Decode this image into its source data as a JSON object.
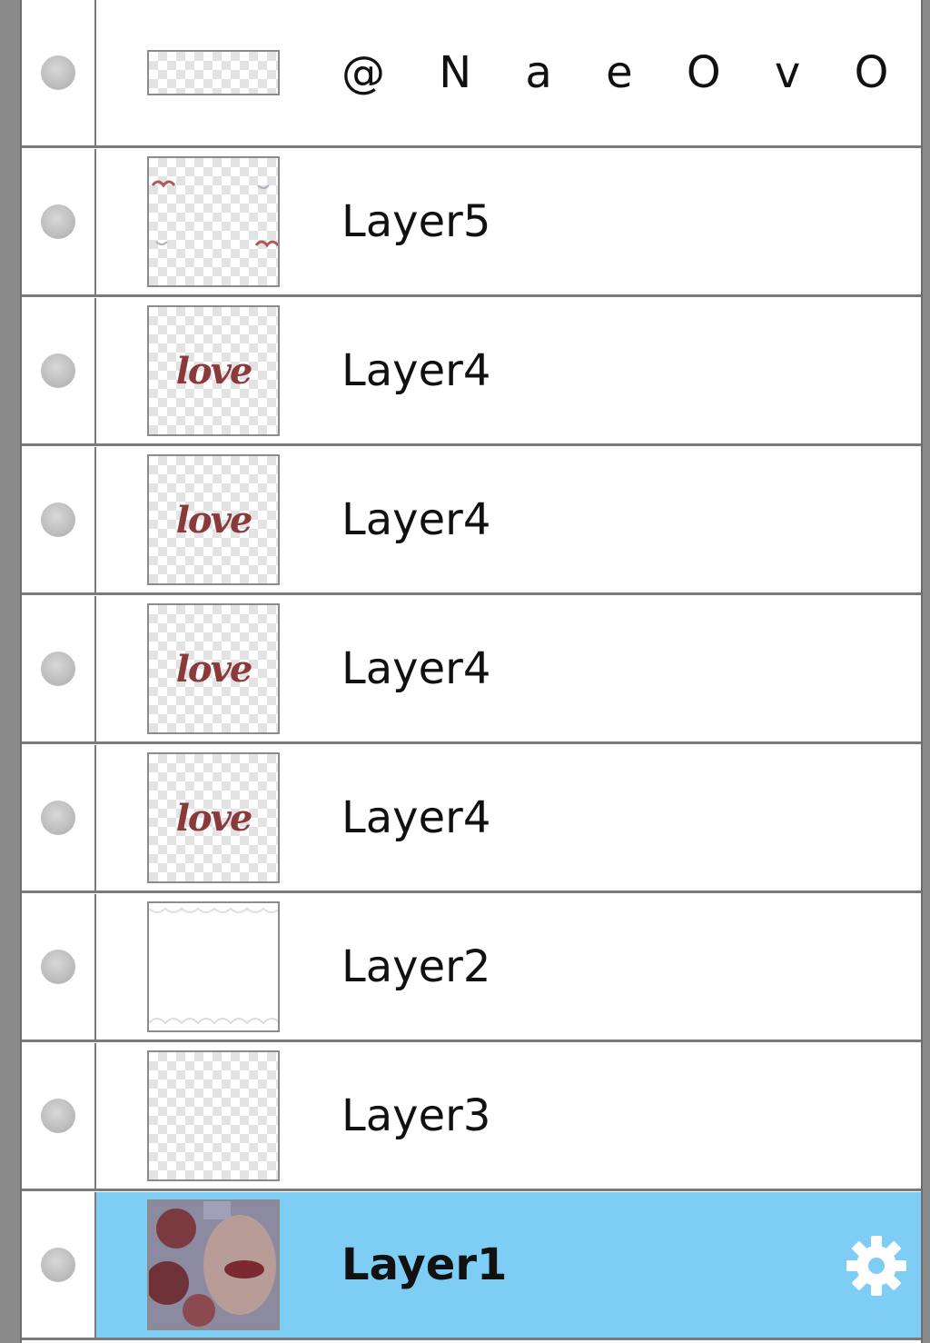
{
  "layers": [
    {
      "name": "@ N a e O v O",
      "thumb": "text-layer"
    },
    {
      "name": "Layer5",
      "thumb": "corner-ornaments"
    },
    {
      "name": "Layer4",
      "thumb": "script-text",
      "thumb_text": "love"
    },
    {
      "name": "Layer4",
      "thumb": "script-text",
      "thumb_text": "love"
    },
    {
      "name": "Layer4",
      "thumb": "script-text",
      "thumb_text": "love"
    },
    {
      "name": "Layer4",
      "thumb": "script-text",
      "thumb_text": "love"
    },
    {
      "name": "Layer2",
      "thumb": "white-frame"
    },
    {
      "name": "Layer3",
      "thumb": "empty"
    },
    {
      "name": "Layer1",
      "thumb": "photo",
      "selected": true
    }
  ],
  "icons": {
    "visibility": "visibility-dot-icon",
    "settings": "gear-icon"
  },
  "colors": {
    "selected_row": "#7ecdf4",
    "thumb_text": "#8a3a3a"
  }
}
